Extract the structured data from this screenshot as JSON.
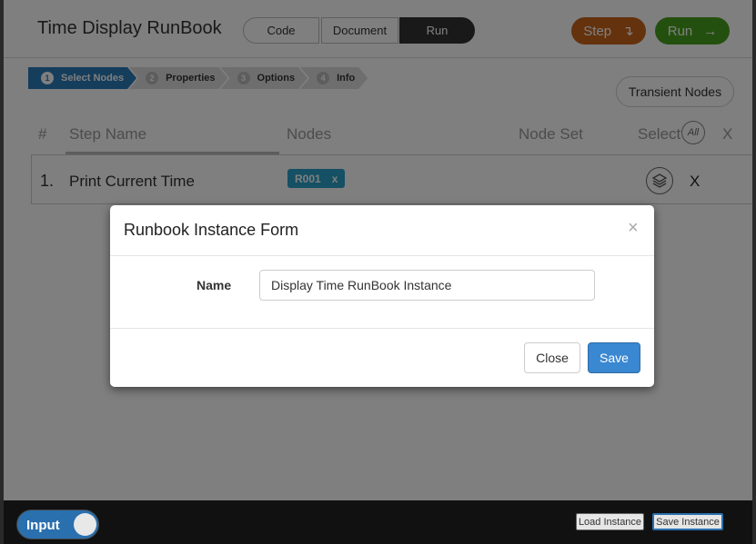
{
  "header": {
    "title": "Time Display RunBook",
    "modes": [
      "Code",
      "Document",
      "Run"
    ],
    "active_mode": "Run",
    "step_label": "Step",
    "step_icon": "↴",
    "run_label": "Run",
    "run_icon": "→",
    "colors": {
      "step": "#c8651b",
      "run": "#48a11f"
    }
  },
  "wizard": {
    "steps": [
      {
        "num": "1",
        "label": "Select Nodes",
        "active": true
      },
      {
        "num": "2",
        "label": "Properties",
        "active": false
      },
      {
        "num": "3",
        "label": "Options",
        "active": false
      },
      {
        "num": "4",
        "label": "Info",
        "active": false
      }
    ],
    "transient_label": "Transient Nodes"
  },
  "table": {
    "headers": {
      "num": "#",
      "step_name": "Step Name",
      "nodes": "Nodes",
      "node_set": "Node Set",
      "select": "Select",
      "select_all": "All",
      "remove": "X"
    },
    "rows": [
      {
        "num": "1.",
        "name": "Print Current Time",
        "node": "R001",
        "node_remove": "x",
        "remove": "X"
      }
    ]
  },
  "modal": {
    "title": "Runbook Instance Form",
    "close_x": "×",
    "name_label": "Name",
    "name_value": "Display Time RunBook Instance",
    "close_label": "Close",
    "save_label": "Save"
  },
  "footer": {
    "toggle_label": "Input",
    "load_label": "Load Instance",
    "save_label": "Save Instance"
  }
}
